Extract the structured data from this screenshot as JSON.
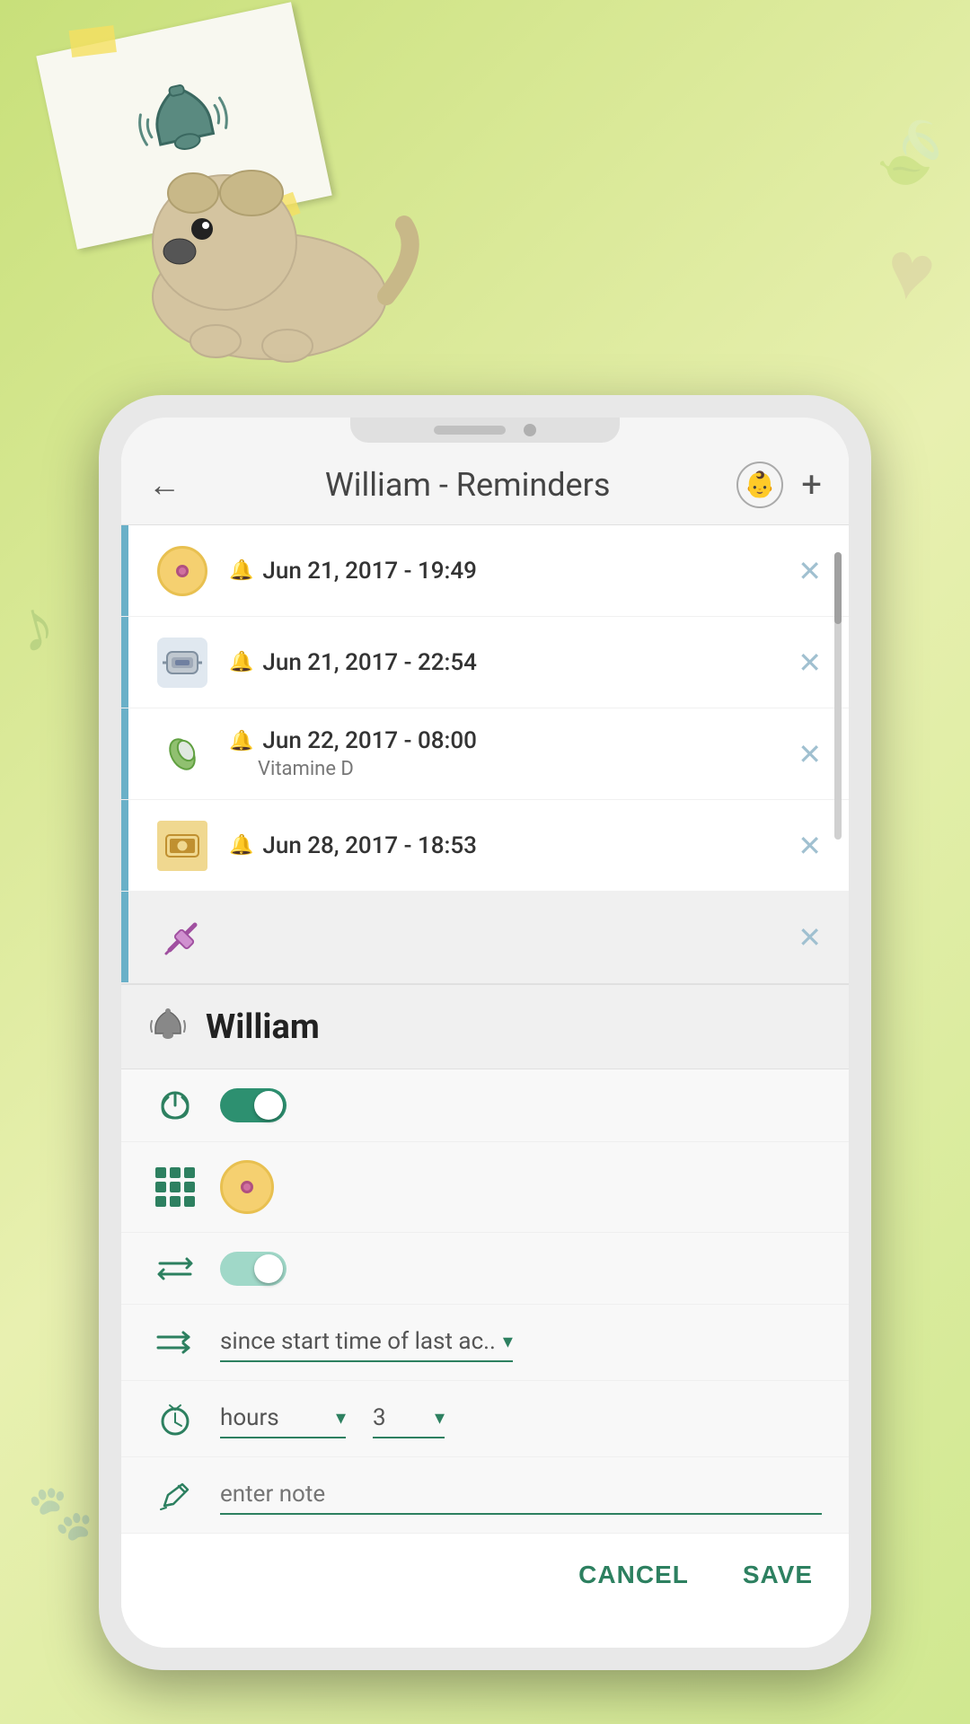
{
  "app": {
    "title": "William - Reminders",
    "back_label": "←",
    "add_label": "+",
    "baby_icon": "👶"
  },
  "reminders": [
    {
      "id": 1,
      "date": "Jun 21, 2017 - 19:49",
      "icon_type": "pill",
      "note": "",
      "delete_label": "✕"
    },
    {
      "id": 2,
      "date": "Jun 21, 2017 - 22:54",
      "icon_type": "band",
      "note": "",
      "delete_label": "✕"
    },
    {
      "id": 3,
      "date": "Jun 22, 2017 - 08:00",
      "icon_type": "capsule",
      "note": "Vitamine D",
      "delete_label": "✕"
    },
    {
      "id": 4,
      "date": "Jun 28, 2017 - 18:53",
      "icon_type": "band2",
      "note": "",
      "delete_label": "✕"
    },
    {
      "id": 5,
      "date": "",
      "icon_type": "syringe",
      "note": "",
      "delete_label": "✕"
    }
  ],
  "detail": {
    "name": "William",
    "bell_icon": "🔔",
    "enabled_toggle": "on",
    "repeat_toggle": "on",
    "since_label": "since start time of last ac..",
    "time_unit_label": "hours",
    "time_value": "3",
    "note_placeholder": "enter note",
    "cancel_label": "CANCEL",
    "save_label": "SAVE",
    "dropdown_arrow": "▾"
  },
  "icons": {
    "back_arrow": "←",
    "add": "+",
    "bell": "🔔",
    "bell_ringing": "🔔",
    "delete_x": "✕",
    "power": "⏻",
    "grid": "grid",
    "repeat": "↔",
    "arrow_right": "→",
    "timer": "⏱",
    "pencil": "✏"
  },
  "colors": {
    "accent": "#2d8060",
    "left_bar": "#6ab0c8",
    "toggle_on": "#2d9070",
    "toggle_light": "#a0d8c8",
    "delete_icon": "#a0c0d0",
    "header_bg": "#f5f5f5"
  }
}
